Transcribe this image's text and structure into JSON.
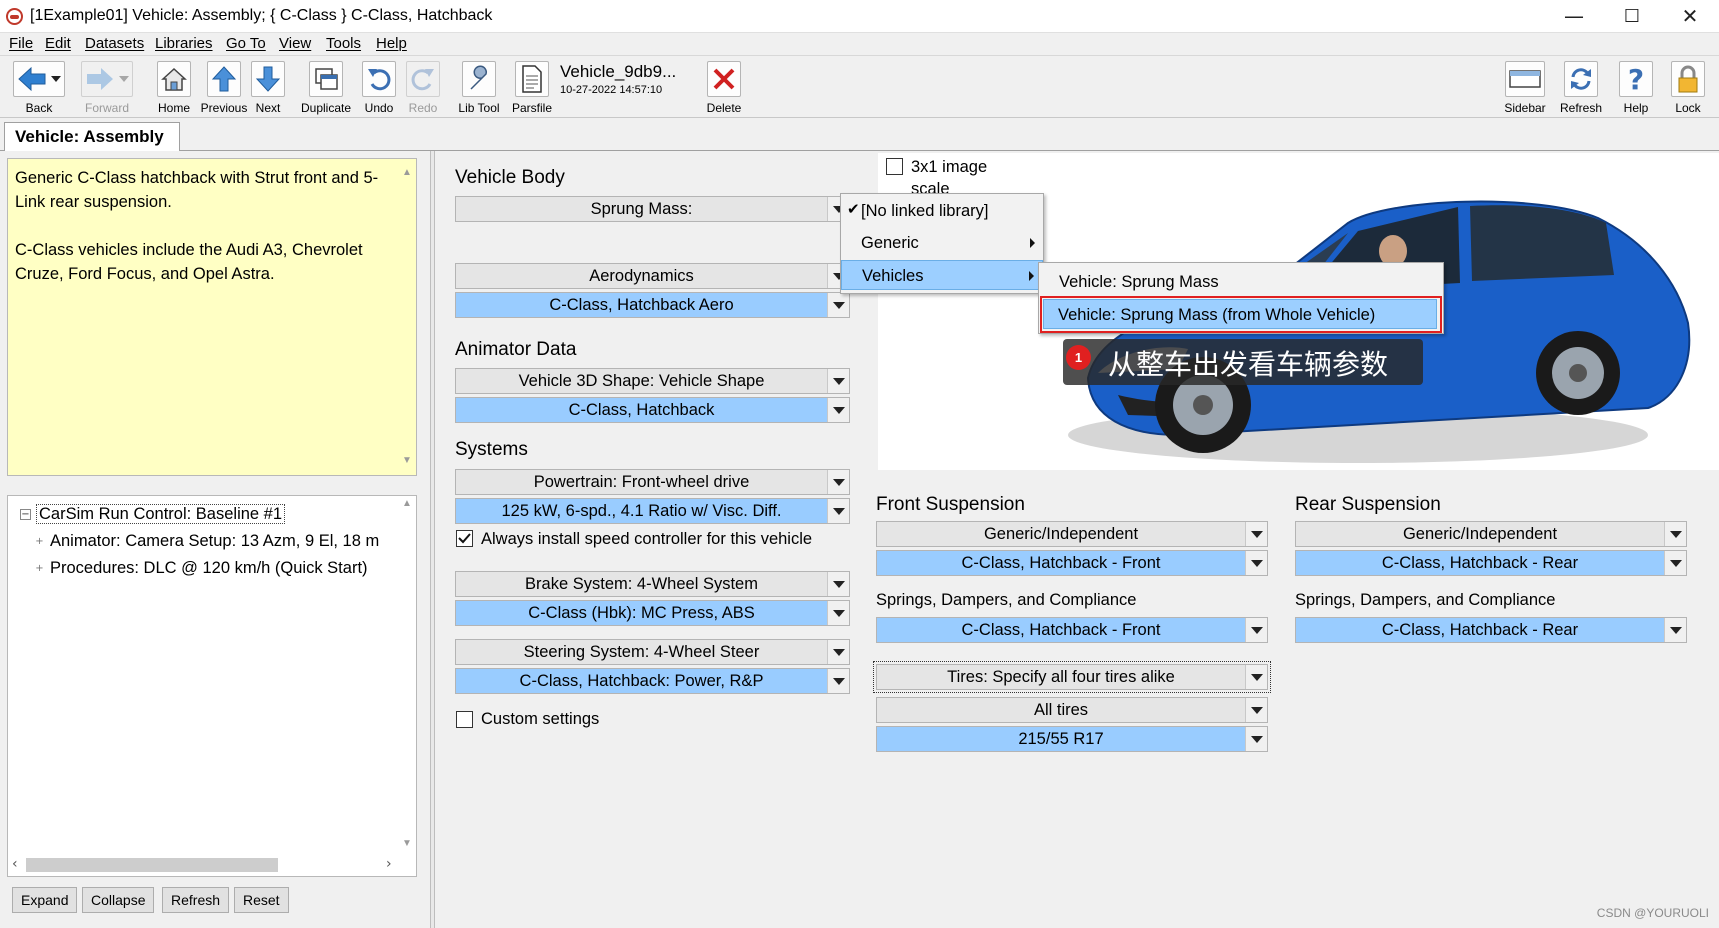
{
  "window": {
    "title": "[1Example01] Vehicle: Assembly; { C-Class } C-Class, Hatchback",
    "minimize": "—",
    "maximize": "☐",
    "close": "✕"
  },
  "menu": [
    "File",
    "Edit",
    "Datasets",
    "Libraries",
    "Go To",
    "View",
    "Tools",
    "Help"
  ],
  "toolbar": {
    "back": "Back",
    "forward": "Forward",
    "home": "Home",
    "previous": "Previous",
    "next": "Next",
    "duplicate": "Duplicate",
    "undo": "Undo",
    "redo": "Redo",
    "lib_tool": "Lib Tool",
    "parsfile": "Parsfile",
    "file_name": "Vehicle_9db9...",
    "file_date": "10-27-2022 14:57:10",
    "delete": "Delete",
    "sidebar": "Sidebar",
    "refresh": "Refresh",
    "help": "Help",
    "lock": "Lock"
  },
  "tab": {
    "label": "Vehicle: Assembly"
  },
  "notes": {
    "line1": "Generic C-Class hatchback with Strut front and 5-Link rear suspension.",
    "line2": "C-Class vehicles include the Audi A3, Chevrolet Cruze, Ford Focus, and Opel Astra."
  },
  "tree": {
    "root": "CarSim Run Control: Baseline #1",
    "child1": "Animator: Camera Setup: 13 Azm, 9 El, 18 m",
    "child2": "Procedures: DLC @ 120 km/h (Quick Start)"
  },
  "bottom_buttons": {
    "expand": "Expand",
    "collapse": "Collapse",
    "refresh": "Refresh",
    "reset": "Reset"
  },
  "vehicle_body": {
    "title": "Vehicle Body",
    "sprung_mass": "Sprung Mass:",
    "aerodynamics": "Aerodynamics",
    "aero_dataset": "C-Class, Hatchback Aero"
  },
  "animator": {
    "title": "Animator Data",
    "shape": "Vehicle 3D Shape: Vehicle Shape",
    "shape_dataset": "C-Class, Hatchback"
  },
  "systems": {
    "title": "Systems",
    "powertrain": "Powertrain: Front-wheel drive",
    "powertrain_dataset": "125 kW, 6-spd., 4.1 Ratio w/ Visc. Diff.",
    "speed_ctrl": "Always install speed controller for this vehicle",
    "brake": "Brake System: 4-Wheel System",
    "brake_dataset": "C-Class (Hbk): MC Press, ABS",
    "steering": "Steering System: 4-Wheel Steer",
    "steering_dataset": "C-Class, Hatchback: Power, R&P",
    "custom": "Custom settings"
  },
  "image": {
    "checkbox_label": "3x1 image",
    "scale_label": "scale"
  },
  "front_susp": {
    "title": "Front Suspension",
    "kin": "Generic/Independent",
    "kin_dataset": "C-Class, Hatchback - Front",
    "sdc_label": "Springs, Dampers, and Compliance",
    "sdc_dataset": "C-Class, Hatchback - Front"
  },
  "rear_susp": {
    "title": "Rear Suspension",
    "kin": "Generic/Independent",
    "kin_dataset": "C-Class, Hatchback - Rear",
    "sdc_label": "Springs, Dampers, and Compliance",
    "sdc_dataset": "C-Class, Hatchback - Rear"
  },
  "tires": {
    "mode": "Tires: Specify all four tires alike",
    "all": "All tires",
    "dataset": "215/55 R17"
  },
  "menu_popup": {
    "no_linked": "[No linked library]",
    "generic": "Generic",
    "vehicles": "Vehicles",
    "sub1": "Vehicle: Sprung Mass",
    "sub2": "Vehicle: Sprung Mass (from Whole Vehicle)"
  },
  "annotation": {
    "badge": "1",
    "text": "从整车出发看车辆参数"
  },
  "watermark": "CSDN @YOURUOLI",
  "colors": {
    "dataset_blue": "#99ccff",
    "notes_yellow": "#ffffc4",
    "highlight_red": "#e02020",
    "car_blue": "#1a5fc8"
  }
}
